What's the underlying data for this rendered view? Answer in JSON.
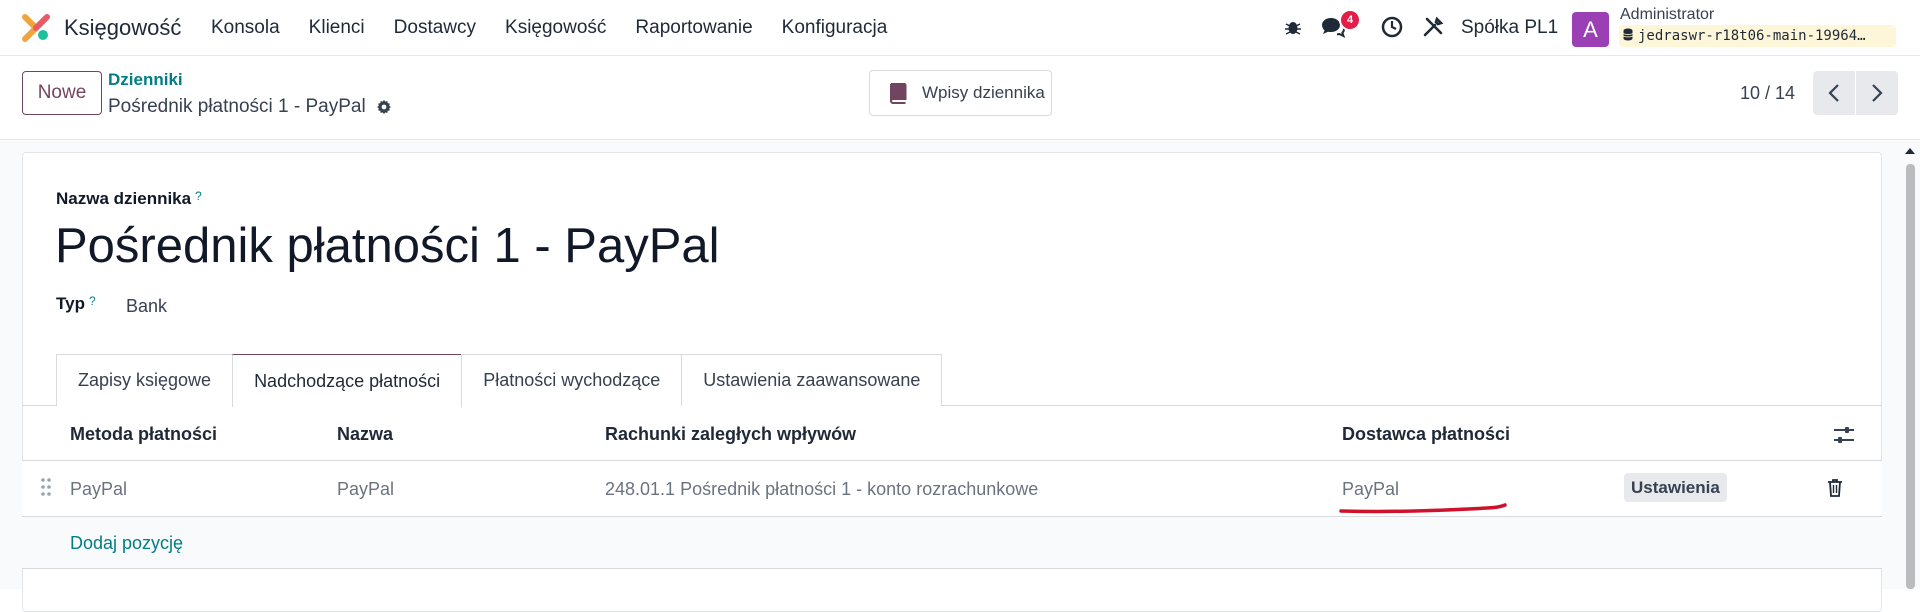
{
  "app": {
    "brand": "Księgowość",
    "menu": [
      "Konsola",
      "Klienci",
      "Dostawcy",
      "Księgowość",
      "Raportowanie",
      "Konfiguracja"
    ],
    "message_count": "4",
    "company": "Spółka PL1",
    "user_initial": "A",
    "user_name": "Administrator",
    "database": "jedraswr-r18t06-main-19964…"
  },
  "control": {
    "new_label": "Nowe",
    "breadcrumb_parent": "Dzienniki",
    "breadcrumb_current": "Pośrednik płatności 1 - PayPal",
    "journal_entries_label": "Wpisy dziennika",
    "pager": "10 / 14"
  },
  "form": {
    "name_label": "Nazwa dziennika",
    "help_mark": "?",
    "name_value": "Pośrednik płatności 1 - PayPal",
    "type_label": "Typ",
    "type_value": "Bank"
  },
  "tabs": [
    {
      "label": "Zapisy księgowe"
    },
    {
      "label": "Nadchodzące płatności"
    },
    {
      "label": "Płatności wychodzące"
    },
    {
      "label": "Ustawienia zaawansowane"
    }
  ],
  "table": {
    "columns": [
      "Metoda płatności",
      "Nazwa",
      "Rachunki zaległych wpływów",
      "Dostawca płatności"
    ],
    "rows": [
      {
        "method": "PayPal",
        "name": "PayPal",
        "account": "248.01.1 Pośrednik płatności 1 - konto rozrachunkowe",
        "provider": "PayPal",
        "settings_label": "Ustawienia"
      }
    ],
    "add_line_label": "Dodaj pozycję"
  },
  "colors": {
    "accent": "#71445f",
    "link": "#017e84",
    "badge": "#e11d48",
    "annotation": "#d0112b"
  }
}
